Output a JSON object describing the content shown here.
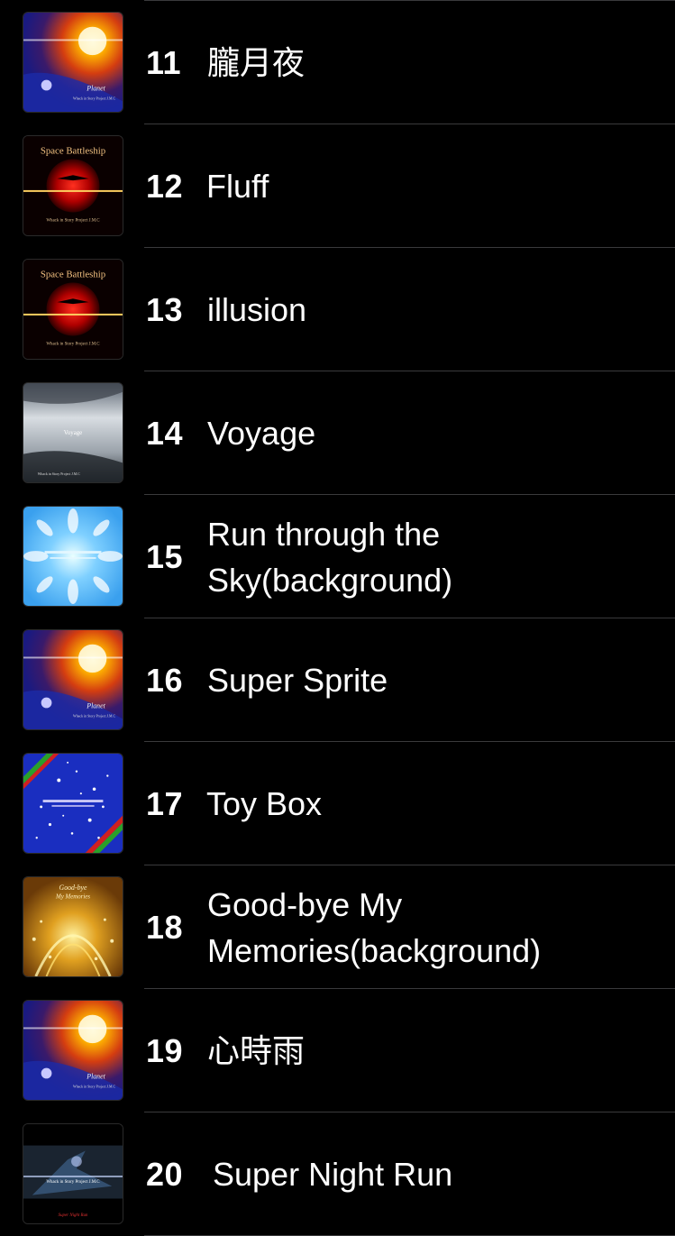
{
  "tracks": [
    {
      "number": "11",
      "title": "朧月夜",
      "artwork": "planet"
    },
    {
      "number": "12",
      "title": "Fluff",
      "artwork": "space-battleship"
    },
    {
      "number": "13",
      "title": "illusion",
      "artwork": "space-battleship"
    },
    {
      "number": "14",
      "title": "Voyage",
      "artwork": "voyage"
    },
    {
      "number": "15",
      "title": "Run through the Sky(background)",
      "artwork": "sky-burst"
    },
    {
      "number": "16",
      "title": "Super Sprite",
      "artwork": "planet"
    },
    {
      "number": "17",
      "title": "Toy Box",
      "artwork": "snow-night"
    },
    {
      "number": "18",
      "title": "Good-bye My Memories(background)",
      "artwork": "goodbye-memories"
    },
    {
      "number": "19",
      "title": "心時雨",
      "artwork": "planet"
    },
    {
      "number": "20",
      "title": "Super Night Run",
      "artwork": "night-run"
    }
  ],
  "artwork_text": {
    "planet_caption": "Planet",
    "planet_credit": "Whack in Story Project J.M.C",
    "battleship_caption": "Space Battleship",
    "battleship_credit": "Whack in Story Project J.M.C",
    "voyage_caption": "Voyage",
    "voyage_credit": "Whack in Story Project J.M.C",
    "goodbye_caption": "Good-bye My Memories",
    "nightrun_caption": "Super Night Run",
    "nightrun_credit": "Whack in Story Project J.M.C"
  },
  "colors": {
    "background": "#000000",
    "text": "#ffffff",
    "separator": "#3a3a3c"
  }
}
